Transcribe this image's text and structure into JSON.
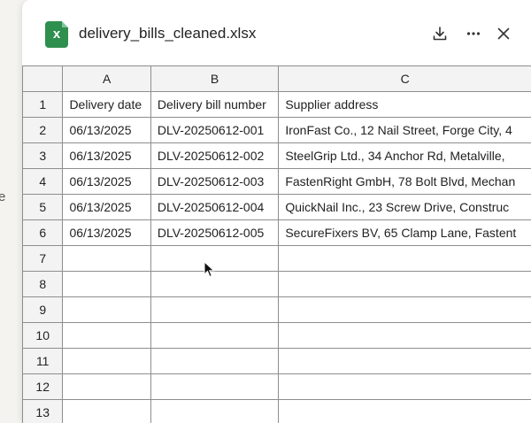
{
  "backdrop": {
    "fragment": "e"
  },
  "header": {
    "file_icon_letter": "x",
    "file_name": "delivery_bills_cleaned.xlsx"
  },
  "icons": {
    "file": "excel-file-icon",
    "download": "download-icon",
    "more": "more-horizontal-icon",
    "close": "close-icon",
    "cursor": "mouse-pointer-icon"
  },
  "colors": {
    "excel_green": "#2f8f4e"
  },
  "sheet": {
    "columns": [
      "A",
      "B",
      "C"
    ],
    "row_numbers": [
      "1",
      "2",
      "3",
      "4",
      "5",
      "6",
      "7",
      "8",
      "9",
      "10",
      "11",
      "12",
      "13"
    ],
    "rows": [
      [
        "Delivery date",
        "Delivery bill number",
        "Supplier address"
      ],
      [
        "06/13/2025",
        "DLV-20250612-001",
        "IronFast Co., 12 Nail Street, Forge City, 4"
      ],
      [
        "06/13/2025",
        "DLV-20250612-002",
        "SteelGrip Ltd., 34 Anchor Rd, Metalville,"
      ],
      [
        "06/13/2025",
        "DLV-20250612-003",
        "FastenRight GmbH, 78 Bolt Blvd, Mechan"
      ],
      [
        "06/13/2025",
        "DLV-20250612-004",
        "QuickNail Inc., 23 Screw Drive, Construc"
      ],
      [
        "06/13/2025",
        "DLV-20250612-005",
        "SecureFixers BV, 65 Clamp Lane, Fastent"
      ],
      [
        "",
        "",
        ""
      ],
      [
        "",
        "",
        ""
      ],
      [
        "",
        "",
        ""
      ],
      [
        "",
        "",
        ""
      ],
      [
        "",
        "",
        ""
      ],
      [
        "",
        "",
        ""
      ],
      [
        "",
        "",
        ""
      ]
    ]
  }
}
